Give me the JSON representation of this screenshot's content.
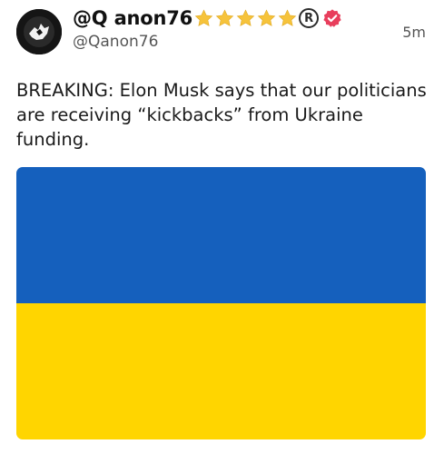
{
  "post": {
    "display_name": "@Q anon76",
    "handle": "@Qanon76",
    "timestamp": "5m",
    "badges": {
      "stars": 5,
      "star_icon": "star-icon",
      "registered_icon": "registered-icon",
      "registered_symbol": "R",
      "verified_icon": "verified-badge-icon",
      "verified_color": "#e83e5c"
    },
    "text": "BREAKING: Elon Musk says that our politicians are receiving “kickbacks” from Ukraine funding.",
    "media": {
      "type": "image",
      "icon": "ukraine-flag",
      "colors": [
        "#1560bd",
        "#ffd500"
      ]
    }
  }
}
